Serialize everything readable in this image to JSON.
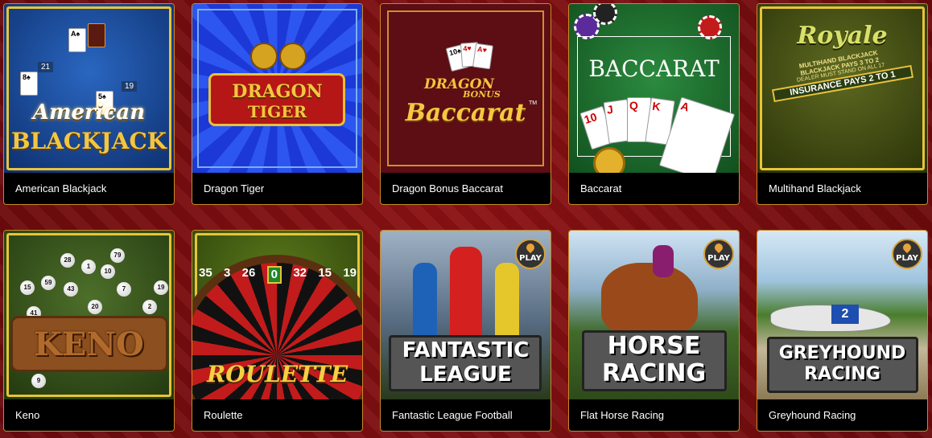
{
  "games": [
    {
      "label": "American Blackjack",
      "art": [
        "American",
        "BLACKJACK"
      ],
      "table_numbers": [
        "21",
        "19"
      ],
      "play_badge": ""
    },
    {
      "label": "Dragon Tiger",
      "art": [
        "DRAGON",
        "TIGER"
      ],
      "table_numbers": [],
      "play_badge": ""
    },
    {
      "label": "Dragon Bonus Baccarat",
      "art": [
        "DRAGON",
        "BONUS",
        "Baccarat",
        "TM"
      ],
      "table_numbers": [],
      "play_badge": ""
    },
    {
      "label": "Baccarat",
      "art": [
        "BACCARAT"
      ],
      "card_ranks": [
        "10",
        "J",
        "Q",
        "K",
        "A"
      ],
      "play_badge": ""
    },
    {
      "label": "Multihand Blackjack",
      "art": [
        "Royale",
        "MULTIHAND BLACKJACK",
        "BLACKJACK PAYS 3 TO 2",
        "DEALER MUST STAND ON ALL 17",
        "INSURANCE PAYS 2 TO 1"
      ],
      "play_badge": ""
    },
    {
      "label": "Keno",
      "art": [
        "KENO"
      ],
      "ball_numbers": [
        "28",
        "1",
        "10",
        "79",
        "15",
        "59",
        "43",
        "19",
        "2",
        "7",
        "41",
        "20",
        "9"
      ],
      "play_badge": ""
    },
    {
      "label": "Roulette",
      "art": [
        "ROULETTE"
      ],
      "wheel_numbers": [
        "35",
        "3",
        "26",
        "0",
        "32",
        "15",
        "19"
      ],
      "play_badge": ""
    },
    {
      "label": "Fantastic League Football",
      "art": [
        "FANTASTIC",
        "LEAGUE"
      ],
      "play_badge": "PLAY"
    },
    {
      "label": "Flat Horse Racing",
      "art": [
        "HORSE",
        "RACING"
      ],
      "play_badge": "PLAY"
    },
    {
      "label": "Greyhound Racing",
      "art": [
        "GREYHOUND",
        "RACING"
      ],
      "bib_number": "2",
      "play_badge": "PLAY"
    }
  ]
}
